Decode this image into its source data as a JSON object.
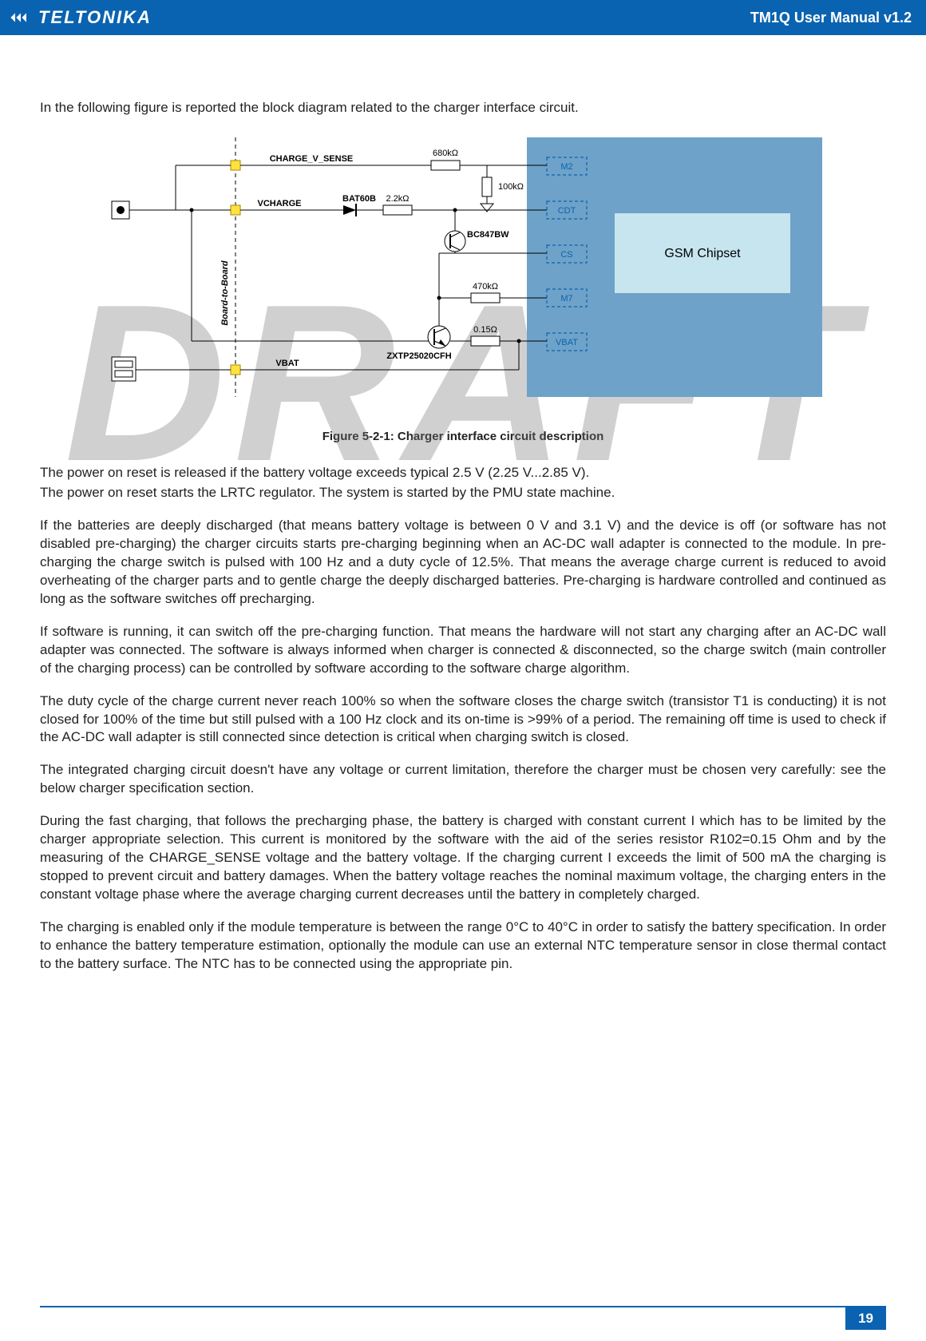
{
  "header": {
    "brand": "TELTONIKA",
    "doc_title": "TM1Q User Manual v1.2"
  },
  "intro": "In the following figure is reported the block diagram related to the charger interface circuit.",
  "figure_caption": "Figure 5-2-1: Charger interface circuit description",
  "diagram": {
    "chip_label": "GSM Chipset",
    "pins": {
      "m2": "M2",
      "cdt": "CDT",
      "cs": "CS",
      "m7": "M7",
      "vbat": "VBAT"
    },
    "left_labels": {
      "charge_v_sense": "CHARGE_V_SENSE",
      "vcharge": "VCHARGE",
      "vbat": "VBAT",
      "board_to_board": "Board-to-Board"
    },
    "components": {
      "r680k": "680kΩ",
      "r100k": "100kΩ",
      "bat60b": "BAT60B",
      "r2_2k": "2.2kΩ",
      "bc847bw": "BC847BW",
      "r470k": "470kΩ",
      "r0_15": "0.15Ω",
      "zxtp": "ZXTP25020CFH"
    }
  },
  "paragraphs": {
    "p1a": "The power on reset is released if the battery voltage exceeds typical 2.5 V (2.25 V...2.85 V).",
    "p1b": "The power on reset starts the LRTC regulator. The system is started by the PMU state machine.",
    "p2": "If the batteries are deeply discharged (that means battery voltage is between 0 V and 3.1 V) and the device is off (or software has not disabled pre-charging) the charger circuits starts pre-charging beginning when an AC-DC wall adapter is connected to the module. In pre-charging the charge switch is pulsed with 100 Hz and a duty cycle of 12.5%. That means the average charge current is reduced to avoid overheating of the charger parts and to gentle charge the deeply discharged batteries. Pre-charging is hardware controlled and continued as long as the software switches off precharging.",
    "p3": "If software is running, it can switch off the pre-charging function. That means the hardware will not start any charging after an AC-DC wall adapter was connected. The software is always informed when charger is connected & disconnected, so the charge switch (main controller of the charging process) can be controlled by software according to the software charge algorithm.",
    "p4": "The duty cycle of the charge current never reach 100% so when  the software closes the charge switch (transistor T1 is conducting) it is not closed for 100% of the time but still pulsed with a 100 Hz clock and its on-time is >99% of a period. The remaining off time is used to check if the AC-DC wall adapter is still connected since detection is critical when charging switch is closed.",
    "p5": "The integrated charging circuit doesn't have any voltage or current limitation, therefore the charger must be chosen very carefully: see the below charger specification section.",
    "p6": "During the fast charging, that follows the precharging phase, the battery is charged with constant current I which has to be limited by the charger appropriate selection. This current is monitored by the software with the aid of the series resistor R102=0.15 Ohm and by the measuring of the CHARGE_SENSE voltage and the battery voltage. If the charging current I exceeds the limit of 500 mA the charging is stopped to prevent circuit and battery damages. When the battery voltage reaches the nominal maximum voltage, the charging enters in the constant voltage phase where the average charging current decreases until the battery in completely charged.",
    "p7": "The charging is enabled only if the module temperature is between the range 0°C to 40°C in order to satisfy the battery specification. In order to enhance the battery temperature estimation, optionally the module can use an external NTC temperature sensor in close thermal contact to the battery surface. The NTC has to be connected using the appropriate pin."
  },
  "page_number": "19",
  "watermark": "DRAFT"
}
